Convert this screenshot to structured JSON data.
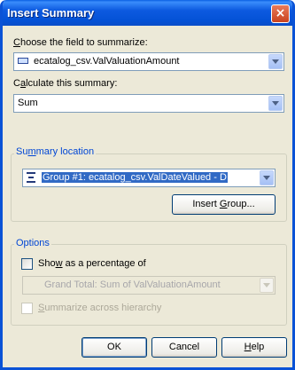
{
  "window": {
    "title": "Insert Summary",
    "close_glyph": "×"
  },
  "field_section": {
    "label_prefix": "C",
    "label_rest": "hoose the field to summarize:",
    "value": "ecatalog_csv.ValValuationAmount",
    "icon": "database-field-icon"
  },
  "summary_section": {
    "label_prefix": "C",
    "label_accel": "a",
    "label_rest": "lculate this summary:",
    "value": "Sum"
  },
  "location": {
    "title_prefix": "Su",
    "title_accel": "m",
    "title_rest": "mary location",
    "value": "Group #1: ecatalog_csv.ValDateValued - D",
    "icon": "group-icon",
    "insert_group_prefix": "Insert ",
    "insert_group_accel": "G",
    "insert_group_rest": "roup..."
  },
  "options": {
    "title": "Options",
    "percentage_prefix": "Sho",
    "percentage_accel": "w",
    "percentage_rest": " as a percentage of",
    "percentage_checked": false,
    "percentage_value": "Grand Total: Sum of ValValuationAmount",
    "hierarchy_prefix": "",
    "hierarchy_accel": "S",
    "hierarchy_rest": "ummarize across hierarchy",
    "hierarchy_checked": false
  },
  "buttons": {
    "ok": "OK",
    "cancel": "Cancel",
    "help_prefix": "",
    "help_accel": "H",
    "help_rest": "elp"
  },
  "colors": {
    "title_bar": "#0452d6",
    "window_bg": "#ece9d8",
    "group_title": "#0046d5",
    "selection": "#316ac5"
  }
}
